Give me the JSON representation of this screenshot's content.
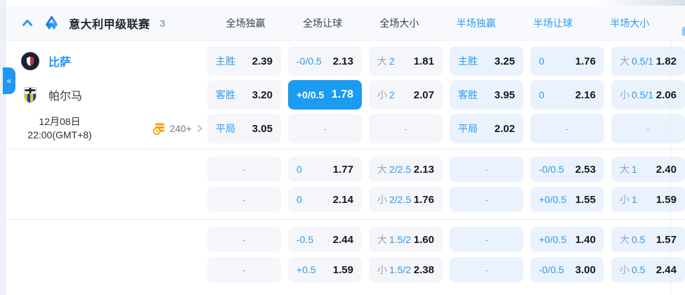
{
  "header": {
    "league_name": "意大利甲级联赛",
    "match_count": "3",
    "columns": [
      {
        "label": "全场独赢",
        "period": "full"
      },
      {
        "label": "全场让球",
        "period": "full"
      },
      {
        "label": "全场大小",
        "period": "full"
      },
      {
        "label": "半场独赢",
        "period": "half"
      },
      {
        "label": "半场让球",
        "period": "half"
      },
      {
        "label": "半场大小",
        "period": "half"
      }
    ]
  },
  "match": {
    "home_team": "比萨",
    "away_team": "帕尔马",
    "date": "12月08日",
    "time": "22:00(GMT+8)",
    "more_markets": "240+"
  },
  "sidebar_toggle_glyph": "«",
  "odds_meta": {
    "empty_placeholder": "-"
  },
  "colors": {
    "accent": "#2196f3",
    "highlight_bg": "#1d9bf0",
    "cell_full_bg": "#f4f6f9",
    "cell_half_bg": "#eaf3fd",
    "more_markets_icon": "#ff9c00"
  },
  "odds_sections": [
    {
      "name": "main-lines",
      "rows": [
        [
          {
            "kind": "1x2",
            "label": "主胜",
            "value": "2.39"
          },
          {
            "kind": "handicap",
            "label": "-0/0.5",
            "value": "2.13"
          },
          {
            "kind": "ou",
            "side": "大",
            "line": "2",
            "value": "1.81"
          },
          {
            "kind": "1x2",
            "label": "主胜",
            "value": "3.25"
          },
          {
            "kind": "handicap",
            "label": "0",
            "value": "1.76"
          },
          {
            "kind": "ou",
            "side": "大",
            "line": "0.5/1",
            "value": "1.82"
          }
        ],
        [
          {
            "kind": "1x2",
            "label": "客胜",
            "value": "3.20"
          },
          {
            "kind": "handicap",
            "label": "+0/0.5",
            "value": "1.78",
            "highlight": true
          },
          {
            "kind": "ou",
            "side": "小",
            "line": "2",
            "value": "2.07"
          },
          {
            "kind": "1x2",
            "label": "客胜",
            "value": "3.95"
          },
          {
            "kind": "handicap",
            "label": "0",
            "value": "2.16"
          },
          {
            "kind": "ou",
            "side": "小",
            "line": "0.5/1",
            "value": "2.06"
          }
        ],
        [
          {
            "kind": "1x2",
            "label": "平局",
            "value": "3.05"
          },
          {
            "kind": "empty"
          },
          {
            "kind": "empty"
          },
          {
            "kind": "1x2",
            "label": "平局",
            "value": "2.02"
          },
          {
            "kind": "empty"
          },
          {
            "kind": "empty"
          }
        ]
      ]
    },
    {
      "name": "alt-lines-1",
      "rows": [
        [
          {
            "kind": "empty"
          },
          {
            "kind": "handicap",
            "label": "0",
            "value": "1.77"
          },
          {
            "kind": "ou",
            "side": "大",
            "line": "2/2.5",
            "value": "2.13"
          },
          {
            "kind": "empty"
          },
          {
            "kind": "handicap",
            "label": "-0/0.5",
            "value": "2.53"
          },
          {
            "kind": "ou",
            "side": "大",
            "line": "1",
            "value": "2.40"
          }
        ],
        [
          {
            "kind": "empty"
          },
          {
            "kind": "handicap",
            "label": "0",
            "value": "2.14"
          },
          {
            "kind": "ou",
            "side": "小",
            "line": "2/2.5",
            "value": "1.76"
          },
          {
            "kind": "empty"
          },
          {
            "kind": "handicap",
            "label": "+0/0.5",
            "value": "1.55"
          },
          {
            "kind": "ou",
            "side": "小",
            "line": "1",
            "value": "1.59"
          }
        ]
      ]
    },
    {
      "name": "alt-lines-2",
      "rows": [
        [
          {
            "kind": "empty"
          },
          {
            "kind": "handicap",
            "label": "-0.5",
            "value": "2.44"
          },
          {
            "kind": "ou",
            "side": "大",
            "line": "1.5/2",
            "value": "1.60"
          },
          {
            "kind": "empty"
          },
          {
            "kind": "handicap",
            "label": "+0/0.5",
            "value": "1.40"
          },
          {
            "kind": "ou",
            "side": "大",
            "line": "0.5",
            "value": "1.57"
          }
        ],
        [
          {
            "kind": "empty"
          },
          {
            "kind": "handicap",
            "label": "+0.5",
            "value": "1.59"
          },
          {
            "kind": "ou",
            "side": "小",
            "line": "1.5/2",
            "value": "2.38"
          },
          {
            "kind": "empty"
          },
          {
            "kind": "handicap",
            "label": "-0/0.5",
            "value": "3.00"
          },
          {
            "kind": "ou",
            "side": "小",
            "line": "0.5",
            "value": "2.44"
          }
        ]
      ]
    }
  ]
}
